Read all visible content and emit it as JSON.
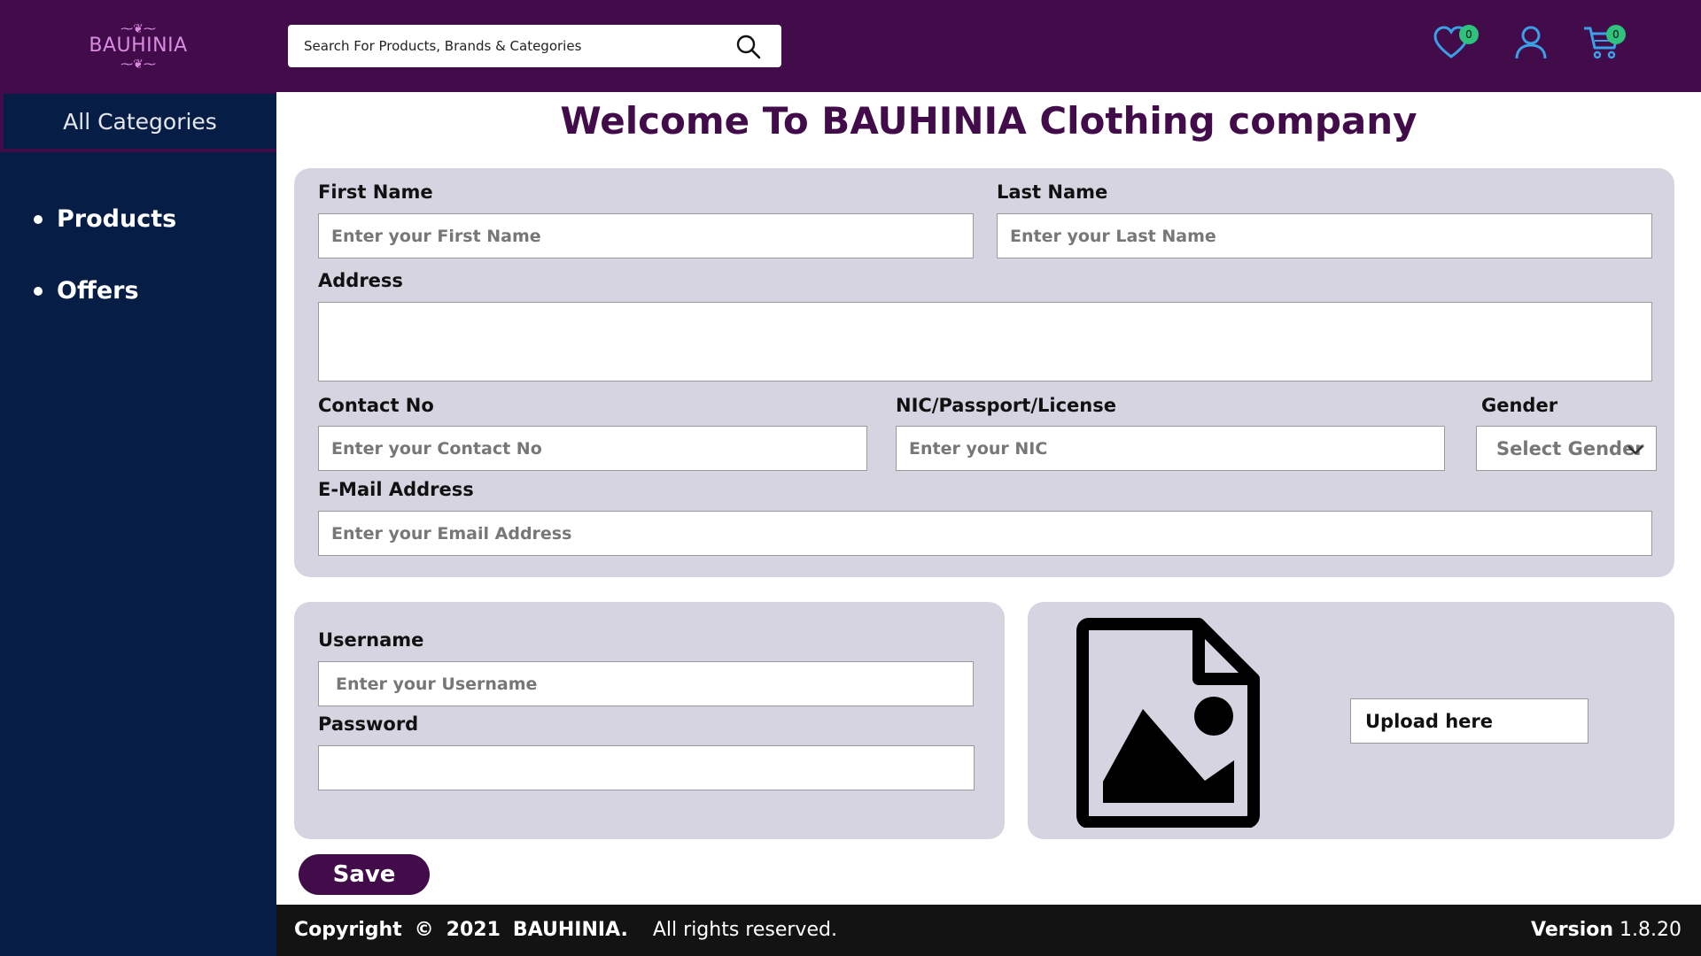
{
  "header": {
    "logo_text": "BAUHINIA",
    "logo_flourish": "⁓❦⁓",
    "search_placeholder": "Search For Products, Brands & Categories",
    "wishlist_count": "0",
    "cart_count": "0"
  },
  "sidebar": {
    "all_categories": "All Categories",
    "items": [
      {
        "label": "Products"
      },
      {
        "label": "Offers"
      }
    ]
  },
  "main": {
    "title": "Welcome To BAUHINIA Clothing company",
    "first_name_label": "First Name",
    "first_name_placeholder": "Enter your First Name",
    "last_name_label": "Last Name",
    "last_name_placeholder": "Enter your Last Name",
    "address_label": "Address",
    "contact_label": "Contact No",
    "contact_placeholder": "Enter your Contact No",
    "nic_label": "NIC/Passport/License",
    "nic_placeholder": "Enter your NIC",
    "gender_label": "Gender",
    "gender_selected": "Select Gender",
    "email_label": "E-Mail Address",
    "email_placeholder": "Enter your Email Address",
    "username_label": "Username",
    "username_placeholder": "Enter your Username",
    "password_label": "Password",
    "upload_label": "Upload here",
    "save_label": "Save"
  },
  "footer": {
    "copyright_word": "Copyright",
    "copyright_symbol": "©",
    "year": "2021",
    "company": "BAUHINIA.",
    "rights": "All rights reserved.",
    "version_label": "Version",
    "version_value": "1.8.20"
  },
  "colors": {
    "header_bg": "#420c4b",
    "sidebar_bg": "#061e45",
    "panel_bg": "#d6d4e0",
    "accent_icons": "#3aa0e8",
    "badge": "#2ec27e",
    "footer_bg": "#131313"
  }
}
